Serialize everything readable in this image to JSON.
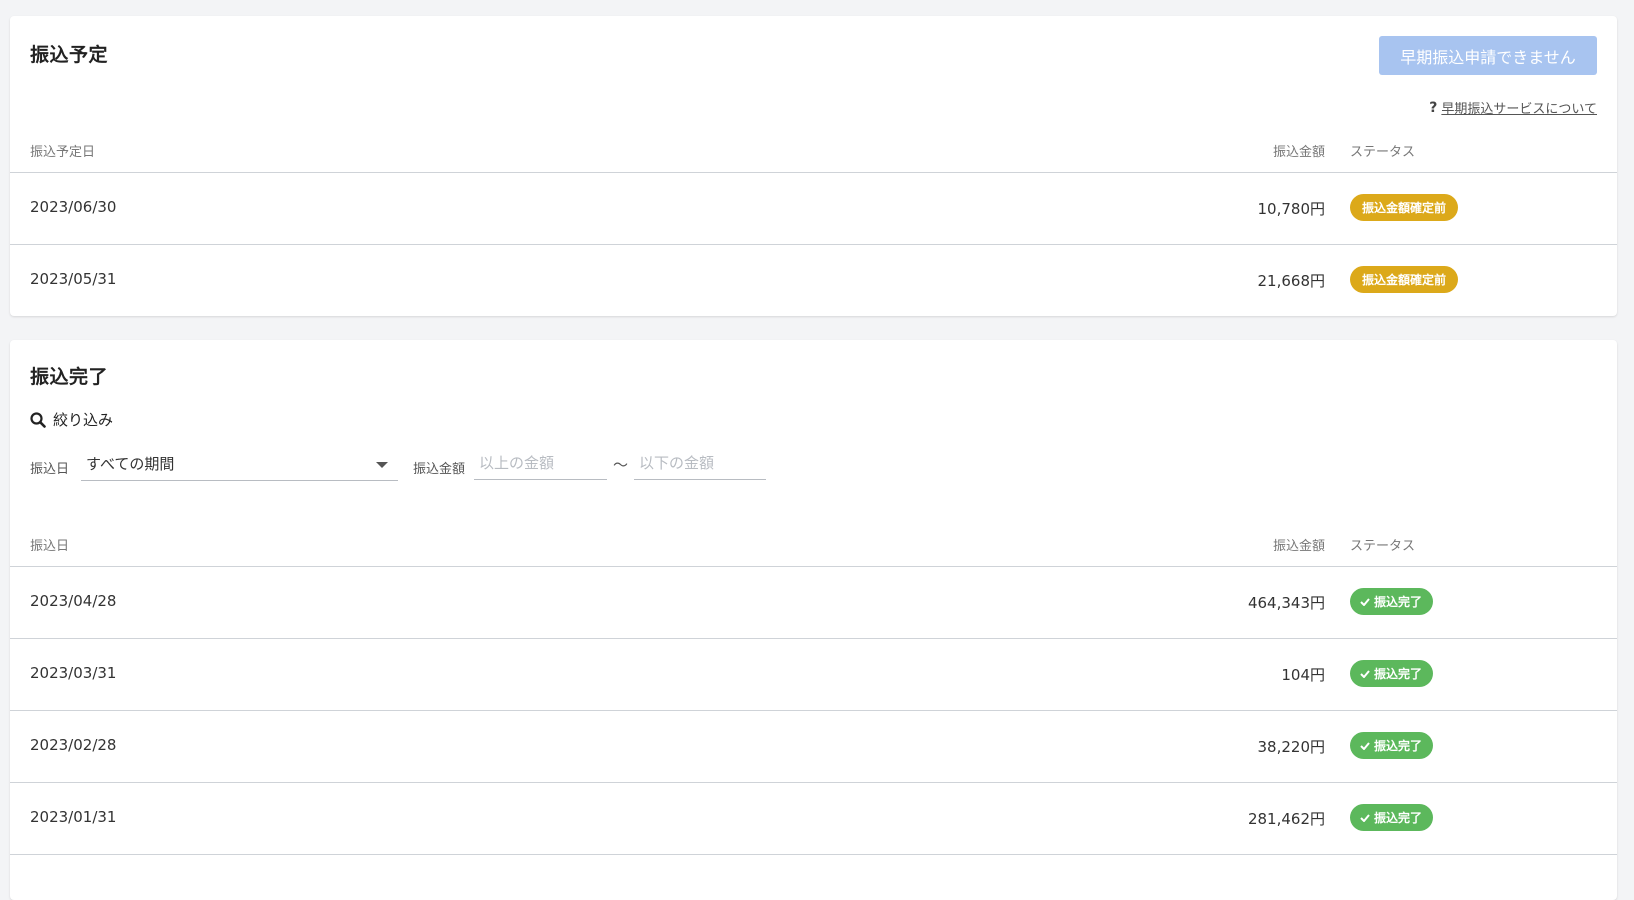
{
  "scheduled": {
    "title": "振込予定",
    "early_button_label": "早期振込申請できません",
    "help_mark": "?",
    "help_link": "早期振込サービスについて",
    "columns": {
      "date": "振込予定日",
      "amount": "振込金額",
      "status": "ステータス"
    },
    "rows": [
      {
        "date": "2023/06/30",
        "amount": "10,780円",
        "status": "振込金額確定前"
      },
      {
        "date": "2023/05/31",
        "amount": "21,668円",
        "status": "振込金額確定前"
      }
    ],
    "status_color": "#dca91a"
  },
  "completed": {
    "title": "振込完了",
    "filter": {
      "title": "絞り込み",
      "date_label": "振込日",
      "date_value": "すべての期間",
      "amount_label": "振込金額",
      "min_placeholder": "以上の金額",
      "separator": "～",
      "max_placeholder": "以下の金額"
    },
    "columns": {
      "date": "振込日",
      "amount": "振込金額",
      "status": "ステータス"
    },
    "rows": [
      {
        "date": "2023/04/28",
        "amount": "464,343円",
        "status": "振込完了"
      },
      {
        "date": "2023/03/31",
        "amount": "104円",
        "status": "振込完了"
      },
      {
        "date": "2023/02/28",
        "amount": "38,220円",
        "status": "振込完了"
      },
      {
        "date": "2023/01/31",
        "amount": "281,462円",
        "status": "振込完了"
      }
    ],
    "status_color": "#5cb85c"
  },
  "icons": {
    "search": "search-icon",
    "caret": "caret-down-icon",
    "check": "check-icon"
  }
}
